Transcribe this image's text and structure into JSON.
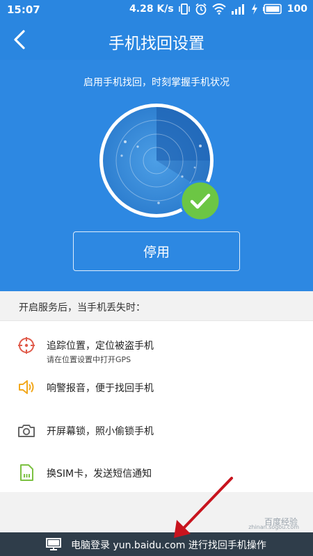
{
  "status_bar": {
    "time": "15:07",
    "speed": "4.28 K/s",
    "battery": "100",
    "icons": [
      "vibrate-icon",
      "alarm-icon",
      "wifi-icon",
      "signal-icon",
      "charging-icon",
      "battery-icon"
    ]
  },
  "app_bar": {
    "title": "手机找回设置",
    "back_icon": "back-arrow-icon"
  },
  "hero": {
    "subtitle": "启用手机找回，时刻掌握手机状况",
    "status_icon": "check-icon",
    "button_label": "停用"
  },
  "section": {
    "header": "开启服务后，当手机丢失时："
  },
  "features": [
    {
      "icon": "crosshair-icon",
      "title": "追踪位置，定位被盗手机",
      "subtitle": "请在位置设置中打开GPS",
      "color": "#e05a4a"
    },
    {
      "icon": "speaker-icon",
      "title": "响警报音，便于找回手机",
      "color": "#f2a81d"
    },
    {
      "icon": "camera-icon",
      "title": "开屏幕锁，照小偷锁手机",
      "color": "#666666"
    },
    {
      "icon": "sim-card-icon",
      "title": "换SIM卡，发送短信通知",
      "color": "#7cc142"
    }
  ],
  "bottom_bar": {
    "icon": "monitor-icon",
    "text": "电脑登录 yun.baidu.com 进行找回手机操作"
  },
  "watermark": {
    "text": "百度经验",
    "url": "zhinan.sogou.com"
  },
  "colors": {
    "brand_blue": "#2a86e0",
    "check_green": "#6cc644",
    "bottom_bar": "#2f3d4a",
    "annotation_arrow": "#c8141e"
  }
}
